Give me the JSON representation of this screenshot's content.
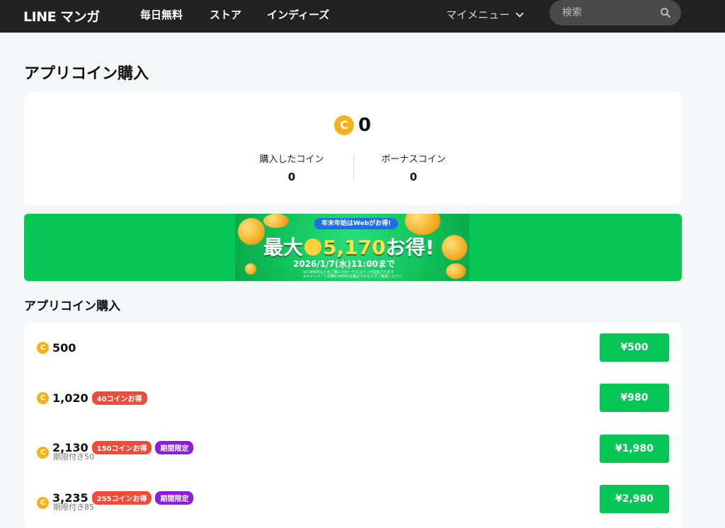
{
  "header": {
    "logo": "LINE マンガ",
    "nav": [
      "毎日無料",
      "ストア",
      "インディーズ"
    ],
    "my_menu": "マイメニュー",
    "search_placeholder": "検索"
  },
  "page_title": "アプリコイン購入",
  "balance": {
    "total": "0",
    "purchased_label": "購入したコイン",
    "purchased_value": "0",
    "bonus_label": "ボーナスコイン",
    "bonus_value": "0"
  },
  "banner": {
    "pill": "年末年始はWebがお得!",
    "prefix": "最大",
    "amount": "5,170",
    "suffix": "お得!",
    "date": "2026/1/7(水)11:00まで",
    "note1": "※1,900円以上のご購入でボーナスコインが追加されます",
    "note2": "※キャンペーン詳細をWEBの記載よりかならずご確認ください"
  },
  "section_title": "アプリコイン購入",
  "products": [
    {
      "coins": "500",
      "badges": [],
      "expiry": "",
      "price": "¥500"
    },
    {
      "coins": "1,020",
      "badges": [
        {
          "text": "40コインお得",
          "kind": "red"
        }
      ],
      "expiry": "",
      "price": "¥980"
    },
    {
      "coins": "2,130",
      "badges": [
        {
          "text": "150コインお得",
          "kind": "red"
        },
        {
          "text": "期間限定",
          "kind": "purple"
        }
      ],
      "expiry": "期限付き50",
      "price": "¥1,980"
    },
    {
      "coins": "3,235",
      "badges": [
        {
          "text": "255コインお得",
          "kind": "red"
        },
        {
          "text": "期間限定",
          "kind": "purple"
        }
      ],
      "expiry": "期限付き85",
      "price": "¥2,980"
    }
  ],
  "colors": {
    "header_bg": "#222222",
    "accent_green": "#06c755",
    "badge_red": "#ee4b3b",
    "badge_purple": "#8d1cde",
    "coin_gold": "#f6b21b"
  }
}
